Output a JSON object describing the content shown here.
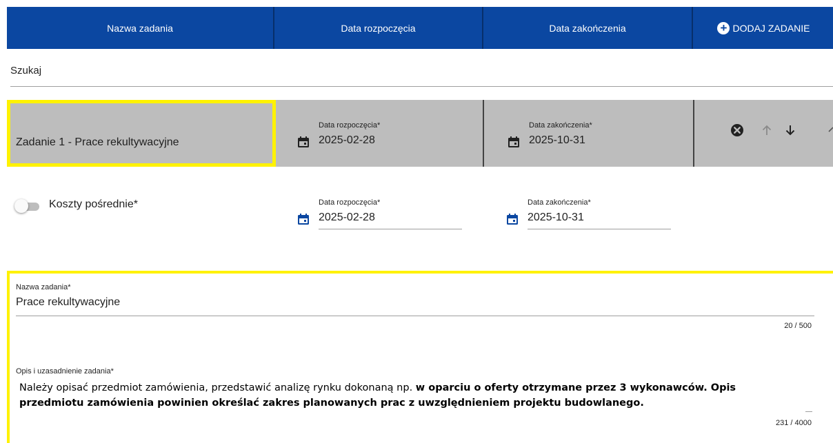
{
  "header": {
    "col_name": "Nazwa zadania",
    "col_start": "Data rozpoczęcia",
    "col_end": "Data zakończenia",
    "add_button": "DODAJ ZADANIE"
  },
  "search": {
    "placeholder": "Szukaj",
    "value": ""
  },
  "task_row": {
    "name": "Zadanie 1 - Prace rekultywacyjne",
    "start_label": "Data rozpoczęcia*",
    "start_value": "2025-02-28",
    "end_label": "Data zakończenia*",
    "end_value": "2025-10-31",
    "icons": [
      "close-circle-icon",
      "arrow-up-icon",
      "arrow-down-icon"
    ]
  },
  "details": {
    "toggle_label": "Koszty pośrednie*",
    "toggle_on": false,
    "start_label": "Data rozpoczęcia*",
    "start_value": "2025-02-28",
    "end_label": "Data zakończenia*",
    "end_value": "2025-10-31"
  },
  "form": {
    "name_label": "Nazwa zadania*",
    "name_value": "Prace rekultywacyjne",
    "name_counter": "20 / 500",
    "desc_label": "Opis i uzasadnienie zadania*",
    "desc_plain": "Należy opisać przedmiot zamówienia, przedstawić analizę rynku dokonaną np. ",
    "desc_bold": "w oparciu o oferty otrzymane przez 3 wykonawców. Opis przedmiotu zamówienia powinien określać zakres planowanych prac z uwzględnieniem projektu budowlanego.",
    "desc_counter": "231 / 4000"
  },
  "colors": {
    "header_bg": "#0b47a1",
    "highlight": "#fff200",
    "row_bg": "#bdbdbd",
    "calendar_active": "#0b47a1"
  }
}
